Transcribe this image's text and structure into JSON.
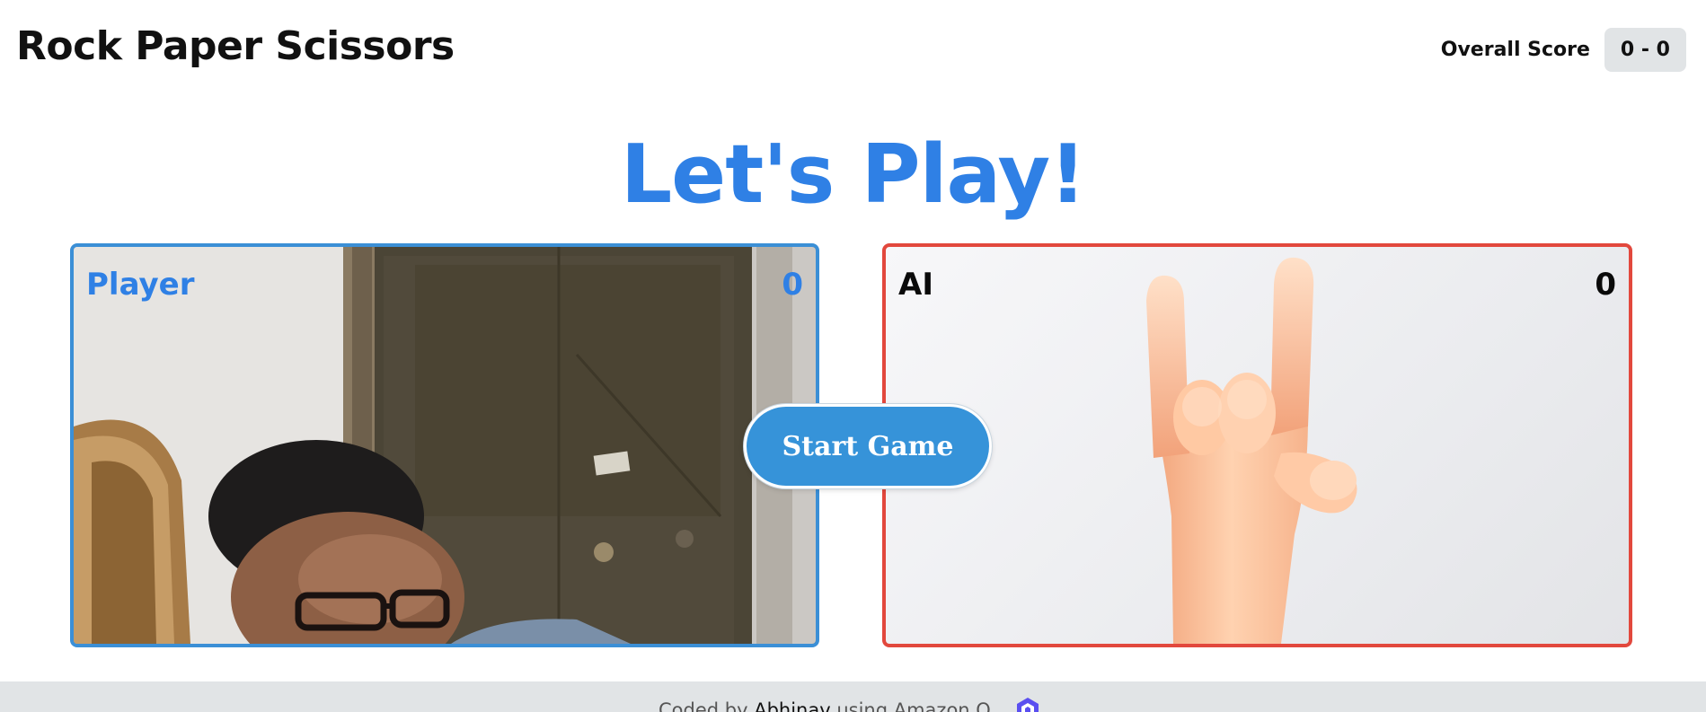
{
  "header": {
    "title": "Rock Paper Scissors",
    "score_label": "Overall Score",
    "score_value": "0 - 0"
  },
  "headline": "Let's Play!",
  "player": {
    "label": "Player",
    "score": "0"
  },
  "ai": {
    "label": "AI",
    "score": "0",
    "gesture_icon": "rock-on-hand-icon"
  },
  "start_button_label": "Start Game",
  "footer": {
    "prefix": "Coded by ",
    "author": "Abhinav",
    "suffix": " using Amazon Q",
    "icon": "amazon-q-icon"
  },
  "colors": {
    "accent_blue": "#2f80e5",
    "button_blue": "#3693d9",
    "player_border": "#3b8fd6",
    "ai_border": "#e2483d",
    "footer_bg": "#e1e4e6"
  }
}
